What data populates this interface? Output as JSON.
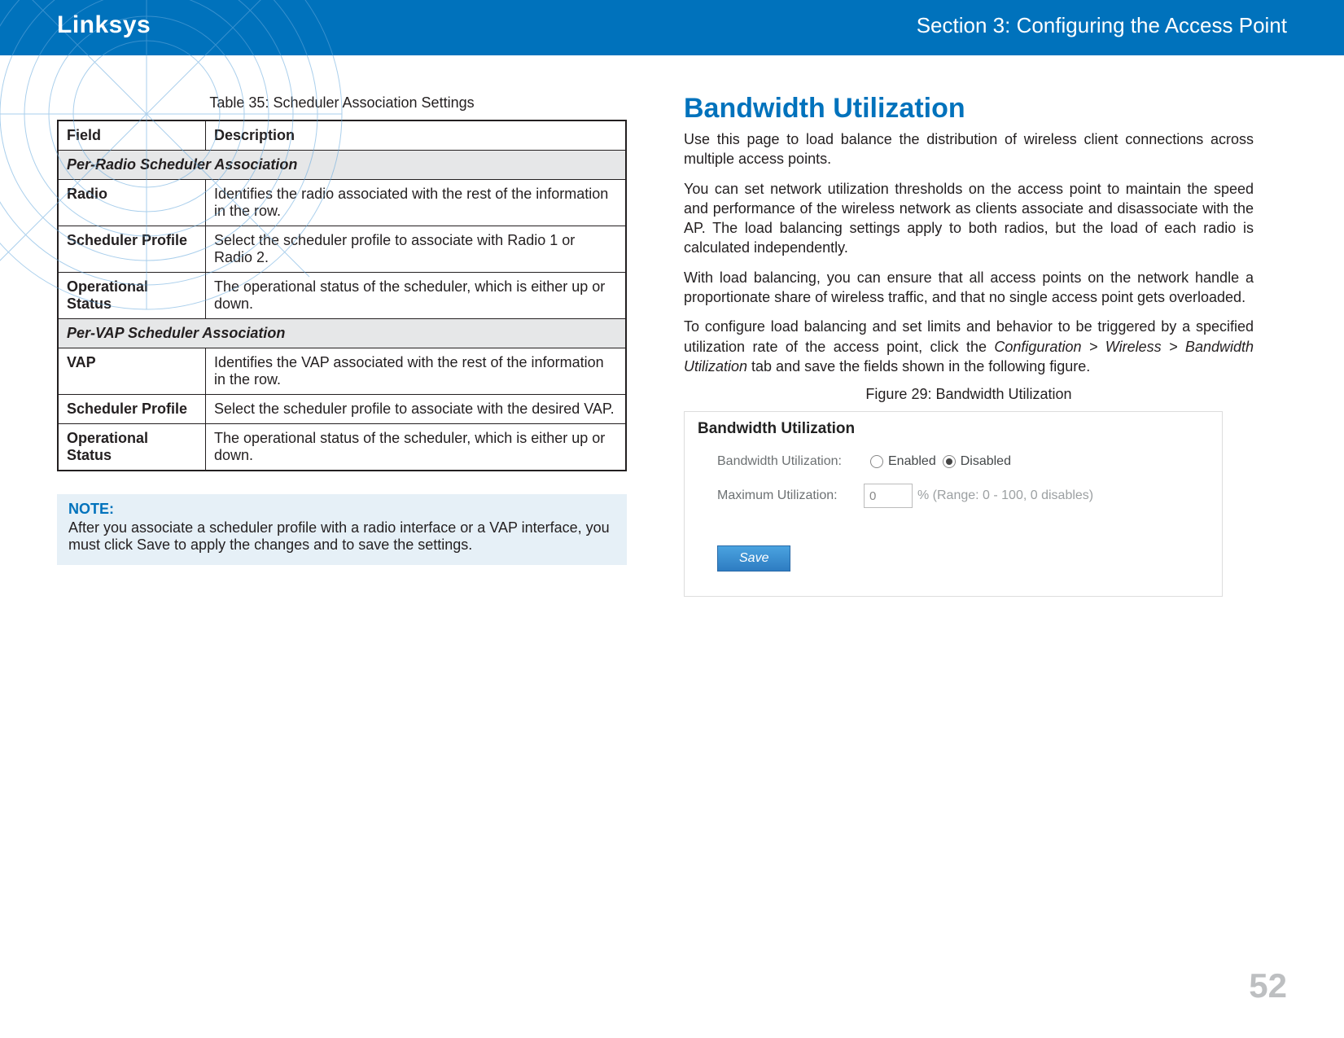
{
  "header": {
    "brand": "Linksys",
    "section": "Section 3:  Configuring the Access Point"
  },
  "left": {
    "table_caption": "Table 35: Scheduler Association Settings",
    "headers": {
      "field": "Field",
      "description": "Description"
    },
    "sections": {
      "per_radio": "Per-Radio Scheduler Association",
      "per_vap": "Per-VAP Scheduler Association"
    },
    "rows": {
      "radio": {
        "label": "Radio",
        "desc": "Identifies the radio associated with the rest of the information in the row."
      },
      "sched_profile_radio": {
        "label": "Scheduler Profile",
        "desc": "Select the scheduler profile to associate with Radio 1 or Radio 2."
      },
      "op_status_radio": {
        "label": "Operational Status",
        "desc": "The operational status of the scheduler, which is either up or down."
      },
      "vap": {
        "label": "VAP",
        "desc": "Identifies the VAP associated with the rest of the information in the row."
      },
      "sched_profile_vap": {
        "label": "Scheduler Profile",
        "desc": "Select the scheduler profile to associate with the desired VAP."
      },
      "op_status_vap": {
        "label": "Operational Status",
        "desc": "The operational status of the scheduler, which is either up or down."
      }
    },
    "note": {
      "title": "NOTE:",
      "body": "After you associate a scheduler profile with a radio interface or a VAP interface, you must click Save to apply the changes and to save the settings."
    }
  },
  "right": {
    "heading": "Bandwidth Utilization",
    "p1": "Use this page to load balance the distribution of wireless client connections across multiple access points.",
    "p2": "You can set network utilization thresholds on the access point to maintain the speed and performance of the wireless network as clients associate and disassociate with the AP. The load balancing settings apply to both radios, but the load of each radio is calculated independently.",
    "p3": "With load balancing, you can ensure that all access points on the network handle a proportionate share of wireless traffic, and that no single access point gets overloaded.",
    "p4a": "To configure load balancing and set limits and behavior to be triggered by a specified utilization rate of the access point, click the ",
    "p4b": "Configuration > Wireless > Bandwidth Utilization",
    "p4c": " tab and save the fields shown in the following figure.",
    "fig_caption": "Figure 29: Bandwidth Utilization",
    "figure": {
      "title": "Bandwidth Utilization",
      "bw_label": "Bandwidth Utilization:",
      "enabled": "Enabled",
      "disabled": "Disabled",
      "max_label": "Maximum Utilization:",
      "max_value": "0",
      "hint": "% (Range: 0 - 100, 0 disables)",
      "save": "Save"
    }
  },
  "page_number": "52"
}
